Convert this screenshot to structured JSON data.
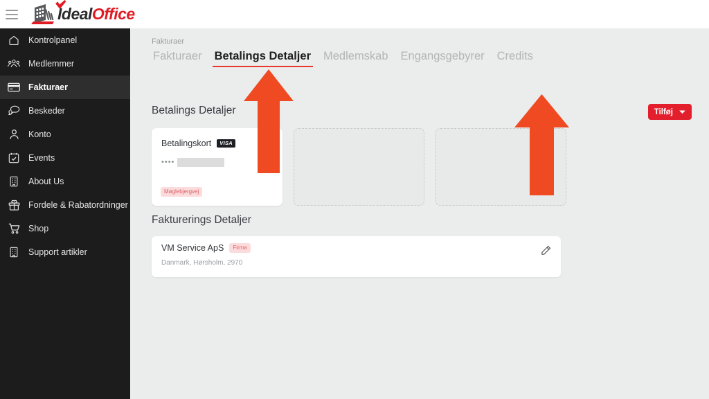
{
  "topbar": {
    "menu_icon": "hamburger-icon",
    "logo_primary": "Ideal",
    "logo_secondary": "Office"
  },
  "sidebar": {
    "items": [
      {
        "label": "Kontrolpanel",
        "icon": "home-icon",
        "active": false
      },
      {
        "label": "Medlemmer",
        "icon": "users-icon",
        "active": false
      },
      {
        "label": "Fakturaer",
        "icon": "credit-card-icon",
        "active": true
      },
      {
        "label": "Beskeder",
        "icon": "chat-icon",
        "active": false
      },
      {
        "label": "Konto",
        "icon": "person-icon",
        "active": false
      },
      {
        "label": "Events",
        "icon": "calendar-check-icon",
        "active": false
      },
      {
        "label": "About Us",
        "icon": "building-icon",
        "active": false
      },
      {
        "label": "Fordele & Rabatordninger",
        "icon": "gift-icon",
        "active": false
      },
      {
        "label": "Shop",
        "icon": "cart-icon",
        "active": false
      },
      {
        "label": "Support artikler",
        "icon": "building-icon",
        "active": false
      }
    ]
  },
  "main": {
    "breadcrumb": "Fakturaer",
    "tabs": [
      {
        "label": "Fakturaer",
        "active": false
      },
      {
        "label": "Betalings Detaljer",
        "active": true
      },
      {
        "label": "Medlemskab",
        "active": false
      },
      {
        "label": "Engangsgebyrer",
        "active": false
      },
      {
        "label": "Credits",
        "active": false
      }
    ],
    "payment_section": {
      "title": "Betalings Detaljer",
      "add_button_label": "Tilføj",
      "add_button_icon": "chevron-down-icon",
      "card": {
        "title": "Betalingskort",
        "brand_badge": "VISA",
        "masked_number": "••••",
        "redacted": true,
        "tag": "Møglebjergvej"
      },
      "placeholder_count": 2
    },
    "billing_section": {
      "title": "Fakturerings Detaljer",
      "entry": {
        "name": "VM Service ApS",
        "type_tag": "Firma",
        "address": "Danmark, Hørsholm, 2970",
        "edit_icon": "pencil-icon"
      }
    }
  },
  "annotations": {
    "arrows": [
      {
        "name": "arrow-pointing-to-active-tab",
        "color": "#ef4a21"
      },
      {
        "name": "arrow-pointing-to-add-button",
        "color": "#ef4a21"
      }
    ]
  },
  "colors": {
    "brand_red": "#e01b24",
    "accent_red": "#e31e2d",
    "tab_underline": "#e8372a",
    "annotation_orange": "#ef4a21",
    "sidebar_bg": "#1c1c1c",
    "content_bg": "#ebecec"
  }
}
